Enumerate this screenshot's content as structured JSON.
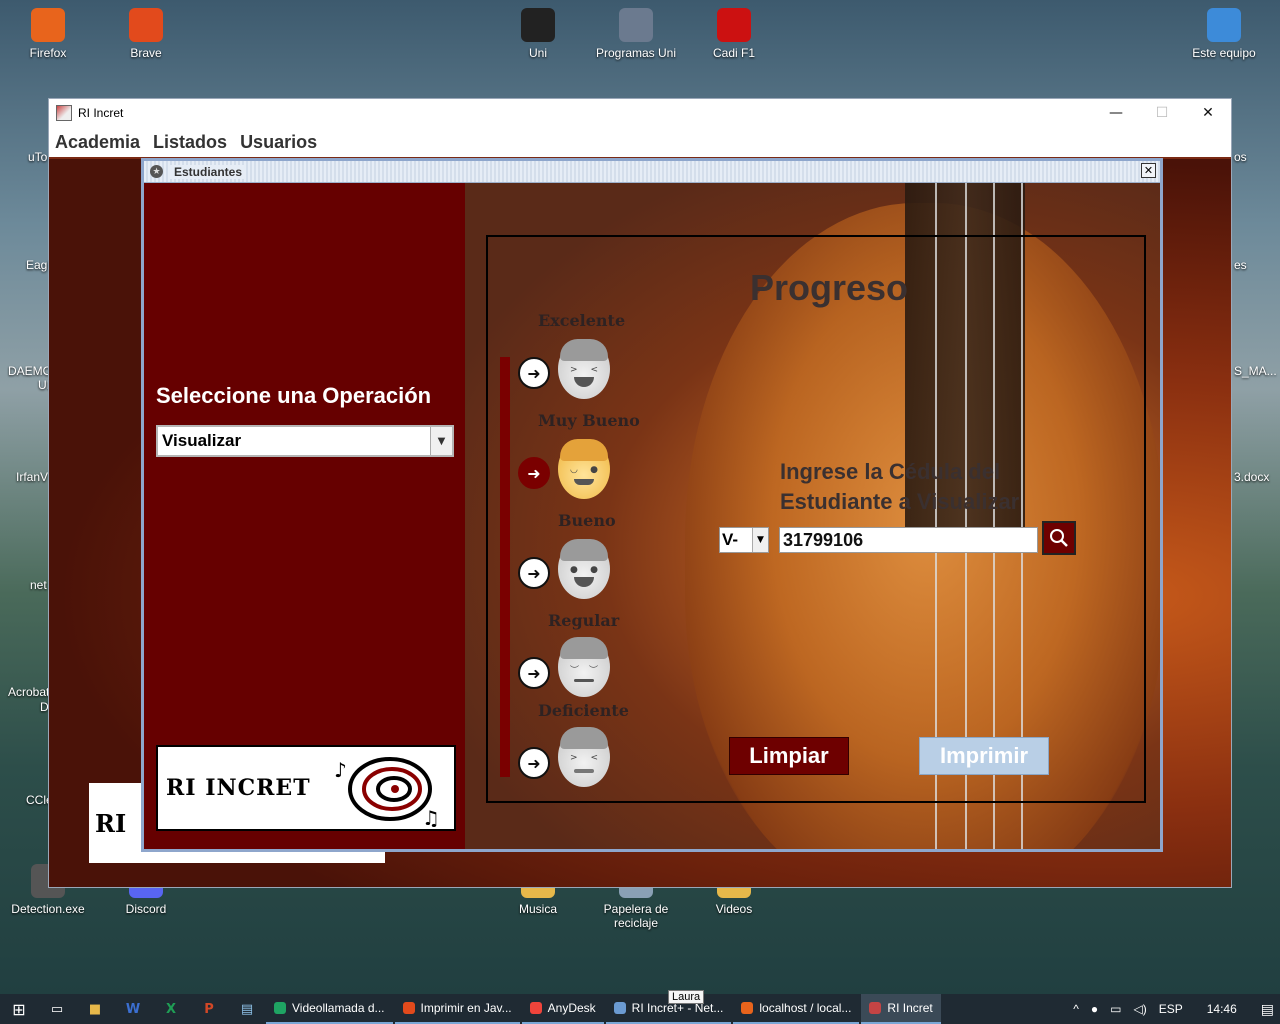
{
  "desktop": {
    "icons": [
      {
        "label": "Firefox",
        "icon": "firefox-icon",
        "color": "#e8641c"
      },
      {
        "label": "Brave",
        "icon": "brave-icon",
        "color": "#e24a1c"
      },
      {
        "label": "Uni",
        "icon": "graduation-cap-icon",
        "color": "#222222"
      },
      {
        "label": "Programas Uni",
        "icon": "paper-plane-icon",
        "color": "#6b7a8f"
      },
      {
        "label": "Cadi F1",
        "icon": "cadi-f1-icon",
        "color": "#cc1111"
      },
      {
        "label": "Este equipo",
        "icon": "computer-icon",
        "color": "#3d8bd9"
      },
      {
        "label": "Detection.exe",
        "icon": "exe-icon",
        "color": "#555555"
      },
      {
        "label": "Discord",
        "icon": "discord-icon",
        "color": "#5865f2"
      },
      {
        "label": "Musica",
        "icon": "folder-icon",
        "color": "#e6b84a"
      },
      {
        "label": "Papelera de reciclaje",
        "icon": "recycle-bin-icon",
        "color": "#8aa0b5"
      },
      {
        "label": "Videos",
        "icon": "folder-icon",
        "color": "#e6b84a"
      }
    ],
    "partial_left": [
      "uTo",
      "Eagl",
      "DAEMO",
      "UI",
      "IrfanV",
      "net",
      "Acrobat",
      "D",
      "CCle"
    ],
    "partial_right": [
      "os",
      "es",
      "S_MA...",
      "3.docx"
    ]
  },
  "window": {
    "title": "RI Incret",
    "minimize": "—",
    "maximize": "☐",
    "close": "✕",
    "menu": [
      "Academia",
      "Listados",
      "Usuarios"
    ],
    "back_logo_text": "RI"
  },
  "frame": {
    "title": "Estudiantes",
    "close": "✕",
    "left": {
      "operation_label": "Seleccione una Operación",
      "operation_value": "Visualizar",
      "logo_text": "RI INCRET"
    },
    "progress": {
      "title": "Progreso",
      "levels": [
        {
          "label": "Excelente",
          "face": "laughing-face-icon",
          "active": false
        },
        {
          "label": "Muy Bueno",
          "face": "winking-face-icon",
          "active": true
        },
        {
          "label": "Bueno",
          "face": "smiling-face-icon",
          "active": false
        },
        {
          "label": "Regular",
          "face": "sleepy-face-icon",
          "active": false
        },
        {
          "label": "Deficiente",
          "face": "upset-face-icon",
          "active": false
        }
      ],
      "cedula_label_line1": "Ingrese la Cédula del",
      "cedula_label_line2": "Estudiante a Visualizar",
      "prefix": "V-",
      "cedula_value": "31799106",
      "clear_label": "Limpiar",
      "print_label": "Imprimir"
    },
    "colors": {
      "accent": "#6e0000",
      "print_disabled": "#b9cfe6",
      "active_face": "#f2bf52"
    }
  },
  "taskbar": {
    "apps": [
      {
        "label": "Videollamada d...",
        "color": "#1fa463"
      },
      {
        "label": "Imprimir en Jav...",
        "color": "#e24a1c"
      },
      {
        "label": "AnyDesk",
        "color": "#ef443b"
      },
      {
        "label": "RI Incret+ - Net...",
        "color": "#6b9bd2"
      },
      {
        "label": "localhost / local...",
        "color": "#e8641c"
      },
      {
        "label": "RI Incret",
        "color": "#c44444"
      }
    ],
    "tray_lang": "ESP",
    "clock": "14:46",
    "tooltip": "Laura"
  }
}
